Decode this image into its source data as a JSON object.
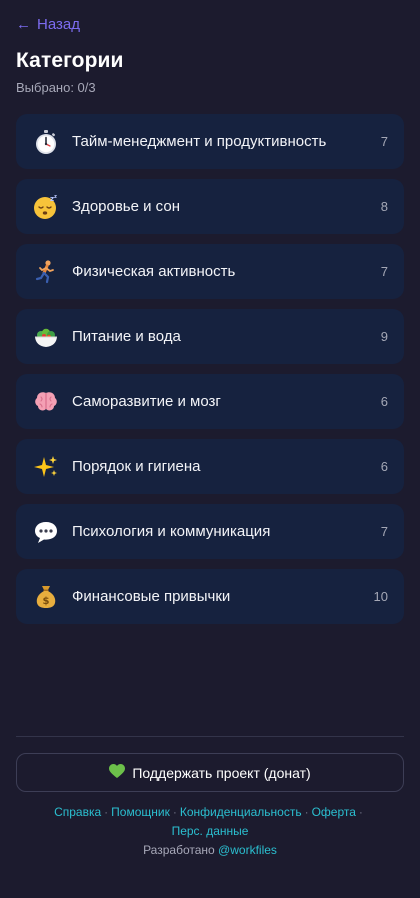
{
  "nav": {
    "back_arrow": "←",
    "back_label": "Назад"
  },
  "header": {
    "title": "Категории",
    "selected_label": "Выбрано: 0/3"
  },
  "categories": [
    {
      "icon": "stopwatch-icon",
      "label": "Тайм-менеджмент и продуктивность",
      "count": "7"
    },
    {
      "icon": "sleeping-face-icon",
      "label": "Здоровье и сон",
      "count": "8"
    },
    {
      "icon": "running-person-icon",
      "label": "Физическая активность",
      "count": "7"
    },
    {
      "icon": "salad-bowl-icon",
      "label": "Питание и вода",
      "count": "9"
    },
    {
      "icon": "brain-icon",
      "label": "Саморазвитие и мозг",
      "count": "6"
    },
    {
      "icon": "sparkles-icon",
      "label": "Порядок и гигиена",
      "count": "6"
    },
    {
      "icon": "speech-bubble-icon",
      "label": "Психология и коммуникация",
      "count": "7"
    },
    {
      "icon": "money-bag-icon",
      "label": "Финансовые привычки",
      "count": "10"
    }
  ],
  "donate": {
    "icon": "green-heart-icon",
    "label": "Поддержать проект (донат)"
  },
  "footer": {
    "links": [
      "Справка",
      "Помощник",
      "Конфиденциальность",
      "Оферта",
      "Перс. данные"
    ],
    "separator": "·",
    "credits_prefix": "Разработано",
    "credits_link": "@workfiles"
  },
  "colors": {
    "background": "#1c1b2e",
    "card": "#16223f",
    "accent_link": "#7c6cf0",
    "footer_link": "#2bbfd0"
  }
}
